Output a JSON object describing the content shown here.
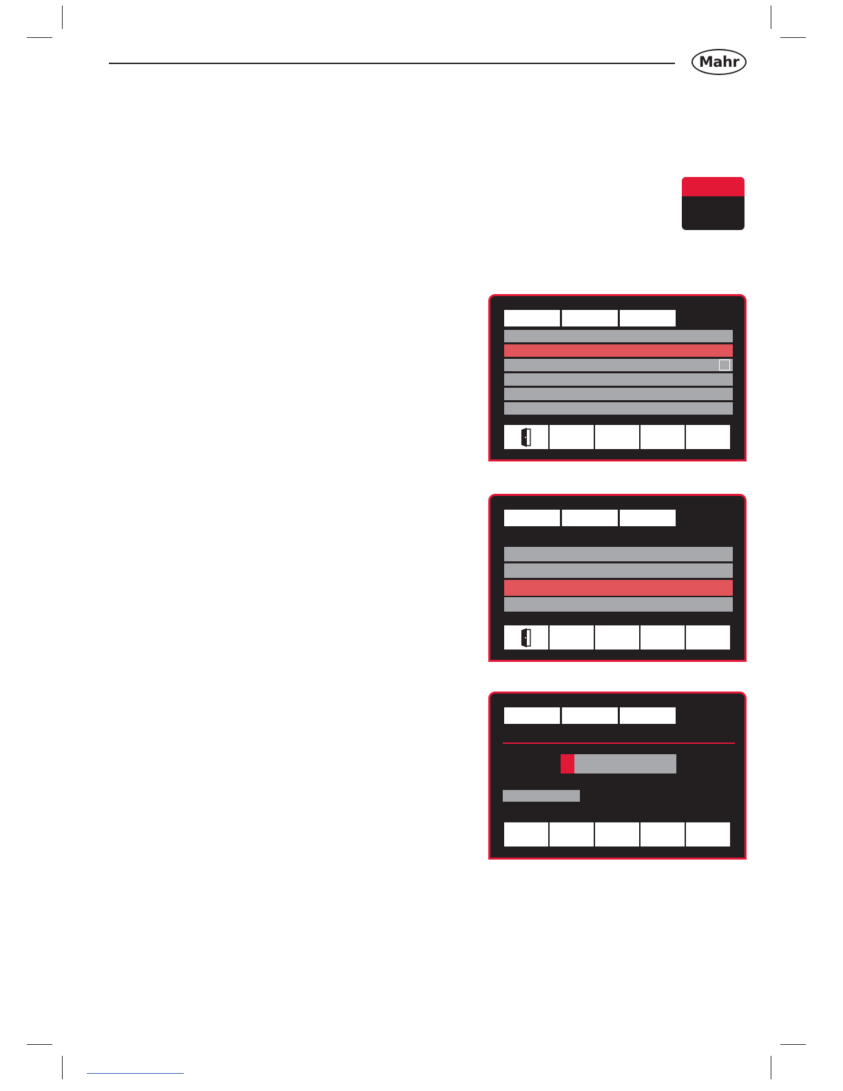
{
  "header": {
    "logo_text": "Mahr"
  },
  "colors": {
    "accent": "#e31837",
    "screen_bg": "#231f20",
    "row_gray": "#a7a9ac",
    "row_selected": "#e2555b"
  },
  "screens": [
    {
      "rows": 6,
      "selected_row": 2,
      "checkbox_row": 3,
      "softkeys": 5,
      "first_softkey_icon": "exit-door-icon"
    },
    {
      "rows": 4,
      "selected_row": 3,
      "softkeys": 5,
      "first_softkey_icon": "exit-door-icon"
    },
    {
      "progress_fraction": 0.12,
      "softkeys": 5
    }
  ]
}
